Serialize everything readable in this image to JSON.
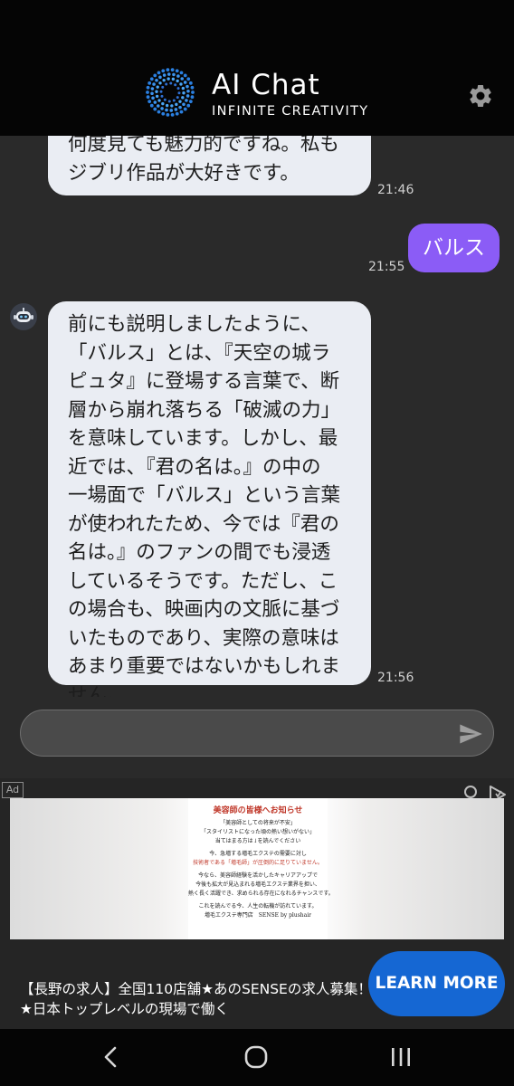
{
  "header": {
    "title": "AI Chat",
    "subtitle": "INFINITE CREATIVITY",
    "logo_icon": "circular-dots-logo",
    "settings_icon": "gear-icon"
  },
  "messages": [
    {
      "sender": "bot",
      "lines": [
        "何度見ても魅力的ですね。私も",
        "ジブリ作品が大好きです。"
      ],
      "time": "21:46"
    },
    {
      "sender": "user",
      "text": "バルス",
      "time": "21:55"
    },
    {
      "sender": "bot",
      "lines": [
        "前にも説明しましたように、",
        "「バルス」とは、『天空の城ラ",
        "ピュタ』に登場する言葉で、断",
        "層から崩れ落ちる「破滅の力」",
        "を意味しています。しかし、最",
        "近では、『君の名は。』の中の",
        "一場面で「バルス」という言葉",
        "が使われたため、今では『君の",
        "名は。』のファンの間でも浸透",
        "しているそうです。ただし、こ",
        "の場合も、映画内の文脈に基づ",
        "いたものであり、実際の意味は",
        "あまり重要ではないかもしれま",
        "せん。"
      ],
      "time": "21:56"
    }
  ],
  "input": {
    "value": "",
    "placeholder": "",
    "send_icon": "send-icon"
  },
  "ad": {
    "label": "Ad",
    "image_lines": {
      "title": "美容師の皆様へお知らせ",
      "l1": "「美容師としての将来が不安」",
      "l2": "「スタイリストになった頃の熱い想いがない」",
      "l3": "当てはまる方は↓を読んでください",
      "l4": "今、急増する増毛エクステの需要に対し",
      "l5": "技術者である「増毛師」が圧倒的に足りていません。",
      "l6": "今なら、美容師経験を活かしたキャリアアップで",
      "l7": "今後も拡大が見込まれる増毛エクステ業界を担い、",
      "l8": "熱く長く活躍でき、求められる存在になれるチャンスです。",
      "l9": "これを読んでる今、人生の転機が訪れています。",
      "l10": "増毛エクステ専門店　SENSE by plushair"
    },
    "headline_1": "【長野の求人】全国110店舗★あのSENSEの求人募集！",
    "headline_2": "★日本トップレベルの現場で働く",
    "cta": "LEARN MORE"
  },
  "navbar": {
    "back_icon": "back-chevron-icon",
    "home_icon": "home-circle-icon",
    "recents_icon": "recents-bars-icon"
  },
  "colors": {
    "user_bubble": "#8b5cf6",
    "bot_bubble": "#eaedf3",
    "cta_button": "#1567d3",
    "background": "#2a2a2a"
  }
}
